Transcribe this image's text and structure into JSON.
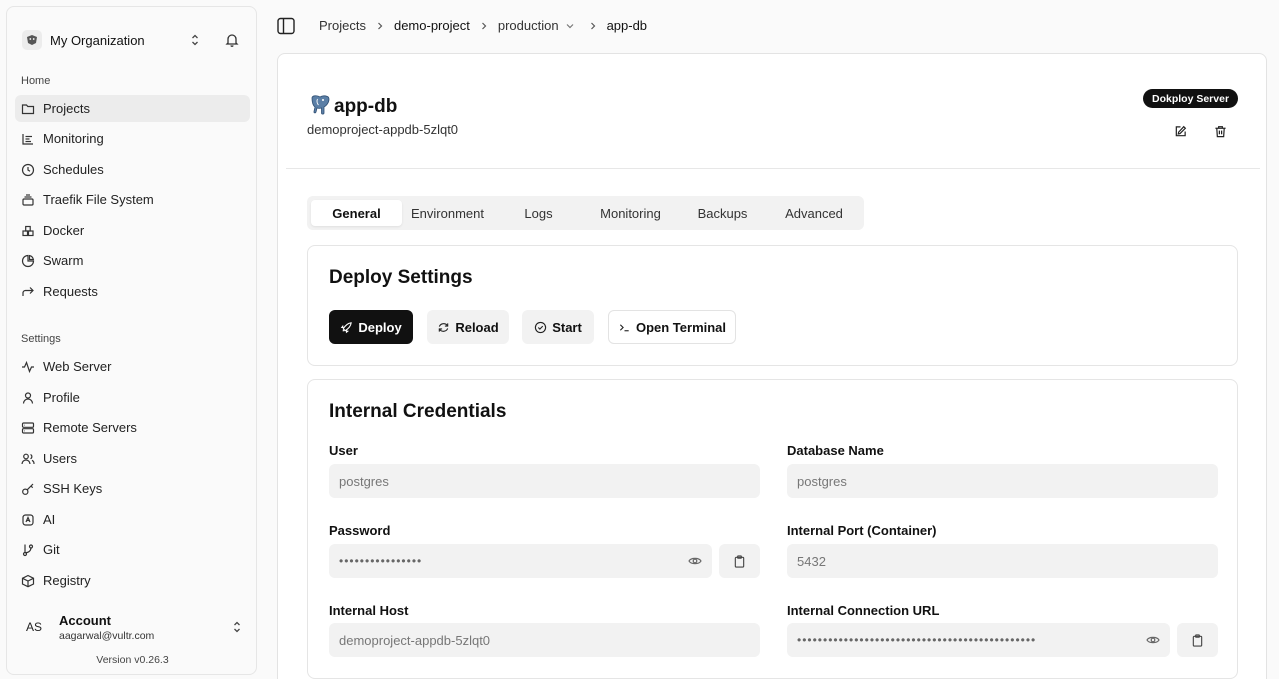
{
  "sidebar": {
    "org_name": "My Organization",
    "home_label": "Home",
    "settings_label": "Settings",
    "home_items": [
      {
        "label": "Projects",
        "icon": "folder-icon",
        "active": true
      },
      {
        "label": "Monitoring",
        "icon": "chart-icon"
      },
      {
        "label": "Schedules",
        "icon": "clock-icon"
      },
      {
        "label": "Traefik File System",
        "icon": "layers-icon"
      },
      {
        "label": "Docker",
        "icon": "boxes-icon"
      },
      {
        "label": "Swarm",
        "icon": "pie-icon"
      },
      {
        "label": "Requests",
        "icon": "forward-icon"
      }
    ],
    "settings_items": [
      {
        "label": "Web Server",
        "icon": "activity-icon"
      },
      {
        "label": "Profile",
        "icon": "user-icon"
      },
      {
        "label": "Remote Servers",
        "icon": "server-icon"
      },
      {
        "label": "Users",
        "icon": "users-icon"
      },
      {
        "label": "SSH Keys",
        "icon": "key-icon"
      },
      {
        "label": "AI",
        "icon": "sparkles-icon"
      },
      {
        "label": "Git",
        "icon": "git-branch-icon"
      },
      {
        "label": "Registry",
        "icon": "package-icon"
      }
    ],
    "account": {
      "initials": "AS",
      "name": "Account",
      "email": "aagarwal@vultr.com"
    },
    "version": "Version v0.26.3"
  },
  "breadcrumb": {
    "items": [
      "Projects",
      "demo-project",
      "production",
      "app-db"
    ]
  },
  "service": {
    "title": "app-db",
    "app_name": "demoproject-appdb-5zlqt0",
    "server_badge": "Dokploy Server"
  },
  "tabs": [
    "General",
    "Environment",
    "Logs",
    "Monitoring",
    "Backups",
    "Advanced"
  ],
  "deploy": {
    "title": "Deploy Settings",
    "buttons": {
      "deploy": "Deploy",
      "reload": "Reload",
      "start": "Start",
      "terminal": "Open Terminal"
    }
  },
  "credentials": {
    "title": "Internal Credentials",
    "user_label": "User",
    "user_value": "postgres",
    "dbname_label": "Database Name",
    "dbname_value": "postgres",
    "password_label": "Password",
    "password_value": "••••••••••••••••",
    "port_label": "Internal Port (Container)",
    "port_value": "5432",
    "host_label": "Internal Host",
    "host_value": "demoproject-appdb-5zlqt0",
    "url_label": "Internal Connection URL",
    "url_value": "••••••••••••••••••••••••••••••••••••••••••••••"
  },
  "colors": {
    "primary": "#111111",
    "active_nav": "#ececec",
    "input_bg": "#f2f2f2"
  }
}
